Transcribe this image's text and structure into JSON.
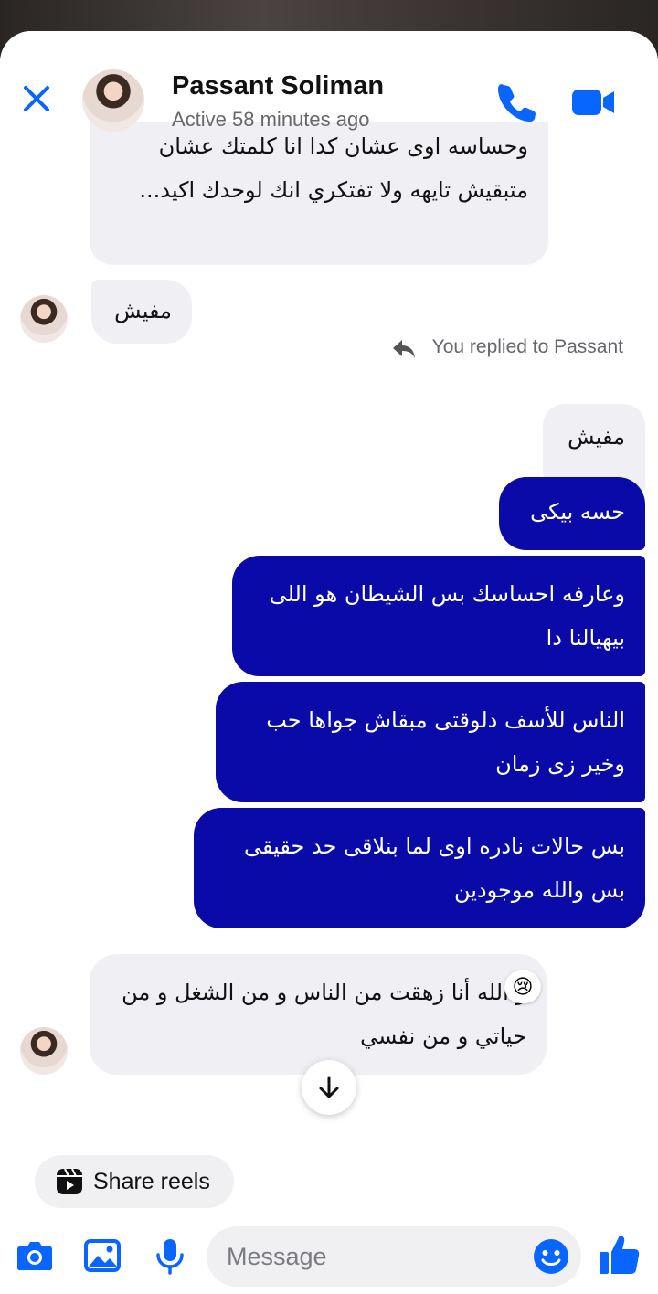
{
  "header": {
    "contact_name": "Passant Soliman",
    "status": "Active 58 minutes ago"
  },
  "thread": {
    "messages": [
      {
        "direction": "incoming",
        "lines": [
          "وحساسه اوى عشان كدا انا كلمتك عشان",
          "متبقيش تايهه ولا تفتكري انك لوحدك اكيد..."
        ]
      },
      {
        "direction": "incoming",
        "lines": [
          "مفيش"
        ]
      },
      {
        "direction": "outgoing",
        "lines": [
          "مفيش"
        ],
        "quoted": true
      },
      {
        "direction": "outgoing",
        "lines": [
          "حسه بيكى"
        ]
      },
      {
        "direction": "outgoing",
        "lines": [
          "وعارفه احساسك بس الشيطان هو اللى",
          "بيهيالنا دا"
        ]
      },
      {
        "direction": "outgoing",
        "lines": [
          "الناس للأسف دلوقتى مبقاش جواها حب",
          "وخير زى زمان"
        ]
      },
      {
        "direction": "outgoing",
        "lines": [
          "بس حالات نادره اوى لما بنلاقى حد حقيقى",
          "بس والله موجودين"
        ]
      },
      {
        "direction": "incoming",
        "lines": [
          "و الله أنا زهقت من الناس و من الشغل و من",
          "حياتي و من نفسي"
        ],
        "reaction": "😢"
      }
    ],
    "replied_label": "You replied to Passant"
  },
  "share_reels": {
    "label": "Share reels"
  },
  "composer": {
    "placeholder": "Message"
  },
  "colors": {
    "accent": "#0866ff",
    "outgoing_bubble": "#0a0aa8",
    "incoming_bubble": "#f0eff3"
  },
  "icons": [
    "close-icon",
    "phone-icon",
    "video-icon",
    "reply-arrow-icon",
    "arrow-down-icon",
    "reels-icon",
    "camera-icon",
    "gallery-icon",
    "microphone-icon",
    "emoji-icon",
    "thumbs-up-icon"
  ]
}
